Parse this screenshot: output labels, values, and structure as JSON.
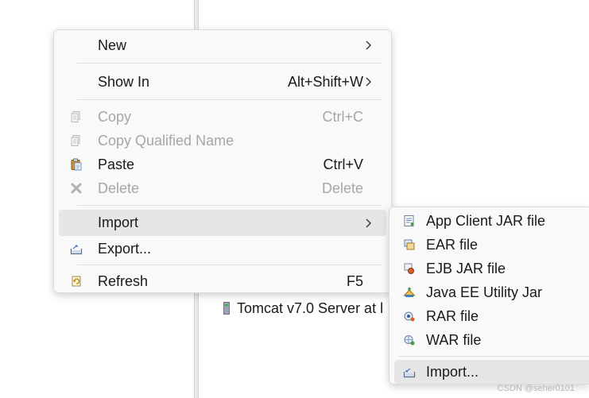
{
  "background": {
    "tree_item_label": "Tomcat v7.0 Server at l"
  },
  "context_menu": {
    "items": [
      {
        "label": "New",
        "shortcut": "",
        "has_submenu": true,
        "enabled": true,
        "icon": "none"
      },
      {
        "label": "Show In",
        "shortcut": "Alt+Shift+W",
        "has_submenu": true,
        "enabled": true,
        "icon": "none"
      },
      {
        "label": "Copy",
        "shortcut": "Ctrl+C",
        "has_submenu": false,
        "enabled": false,
        "icon": "copy-icon"
      },
      {
        "label": "Copy Qualified Name",
        "shortcut": "",
        "has_submenu": false,
        "enabled": false,
        "icon": "copy-qualified-name-icon"
      },
      {
        "label": "Paste",
        "shortcut": "Ctrl+V",
        "has_submenu": false,
        "enabled": true,
        "icon": "paste-icon"
      },
      {
        "label": "Delete",
        "shortcut": "Delete",
        "has_submenu": false,
        "enabled": false,
        "icon": "delete-icon"
      },
      {
        "label": "Import",
        "shortcut": "",
        "has_submenu": true,
        "enabled": true,
        "highlighted": true,
        "icon": "none"
      },
      {
        "label": "Export...",
        "shortcut": "",
        "has_submenu": false,
        "enabled": true,
        "icon": "export-icon"
      },
      {
        "label": "Refresh",
        "shortcut": "F5",
        "has_submenu": false,
        "enabled": true,
        "icon": "refresh-icon"
      }
    ]
  },
  "import_submenu": {
    "items": [
      {
        "label": "App Client JAR file",
        "icon": "app-client-jar-icon"
      },
      {
        "label": "EAR file",
        "icon": "ear-file-icon"
      },
      {
        "label": "EJB JAR file",
        "icon": "ejb-jar-icon"
      },
      {
        "label": "Java EE Utility Jar",
        "icon": "utility-jar-icon"
      },
      {
        "label": "RAR file",
        "icon": "rar-file-icon"
      },
      {
        "label": "WAR file",
        "icon": "war-file-icon"
      },
      {
        "label": "Import...",
        "icon": "import-icon",
        "highlighted": true
      }
    ]
  },
  "watermark": "CSDN @seher0101",
  "colors": {
    "menu_bg": "#f9f9f9",
    "highlight": "#e6e6e6",
    "disabled_text": "#a6a6a6"
  }
}
